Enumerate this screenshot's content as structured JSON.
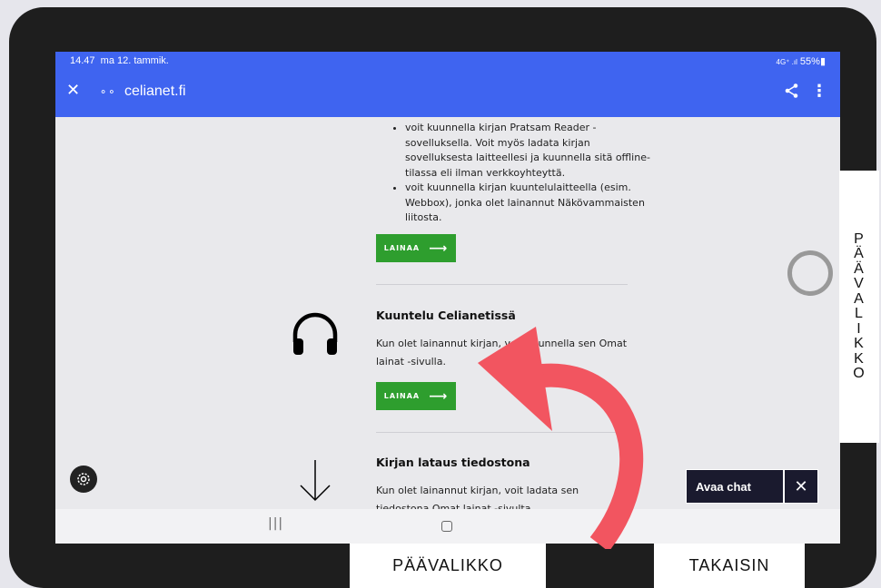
{
  "status_bar": {
    "time": "14.47",
    "date": "ma 12. tammik.",
    "signal": "4G⁺ .ıl",
    "battery": "55%"
  },
  "browser": {
    "url": "celianet.fi",
    "close_icon": "close-icon",
    "share_icon": "share-icon",
    "more_icon": "more-vert-icon"
  },
  "content": {
    "bullets": [
      "voit kuunnella kirjan Pratsam Reader -sovelluksella. Voit myös ladata kirjan sovelluksesta laitteellesi ja kuunnella sitä offline-tilassa eli ilman verkkoyhteyttä.",
      "voit kuunnella kirjan kuuntelulaitteella (esim. Webbox), jonka olet lainannut Näkövammaisten liitosta."
    ],
    "lainaa_label": "LAINAA",
    "section1": {
      "title": "Kuuntelu Celianetissä",
      "text": "Kun olet lainannut kirjan, voit kuunnella sen Omat lainat -sivulla."
    },
    "section2": {
      "title": "Kirjan lataus tiedostona",
      "text": "Kun olet lainannut kirjan, voit ladata sen tiedostona Omat lainat -sivulta."
    }
  },
  "chat": {
    "label": "Avaa chat",
    "close": "✕"
  },
  "side_tab": {
    "letters": [
      "P",
      "Ä",
      "Ä",
      "V",
      "A",
      "L",
      "I",
      "K",
      "K",
      "O"
    ]
  },
  "bottom_labels": {
    "paavalikko": "PÄÄVALIKKO",
    "takaisin": "TAKAISIN"
  },
  "colors": {
    "browser_bar": "#3f64f0",
    "button_green": "#2e9e2e",
    "annotation_red": "#f25560",
    "frame": "#1e1e1e"
  }
}
